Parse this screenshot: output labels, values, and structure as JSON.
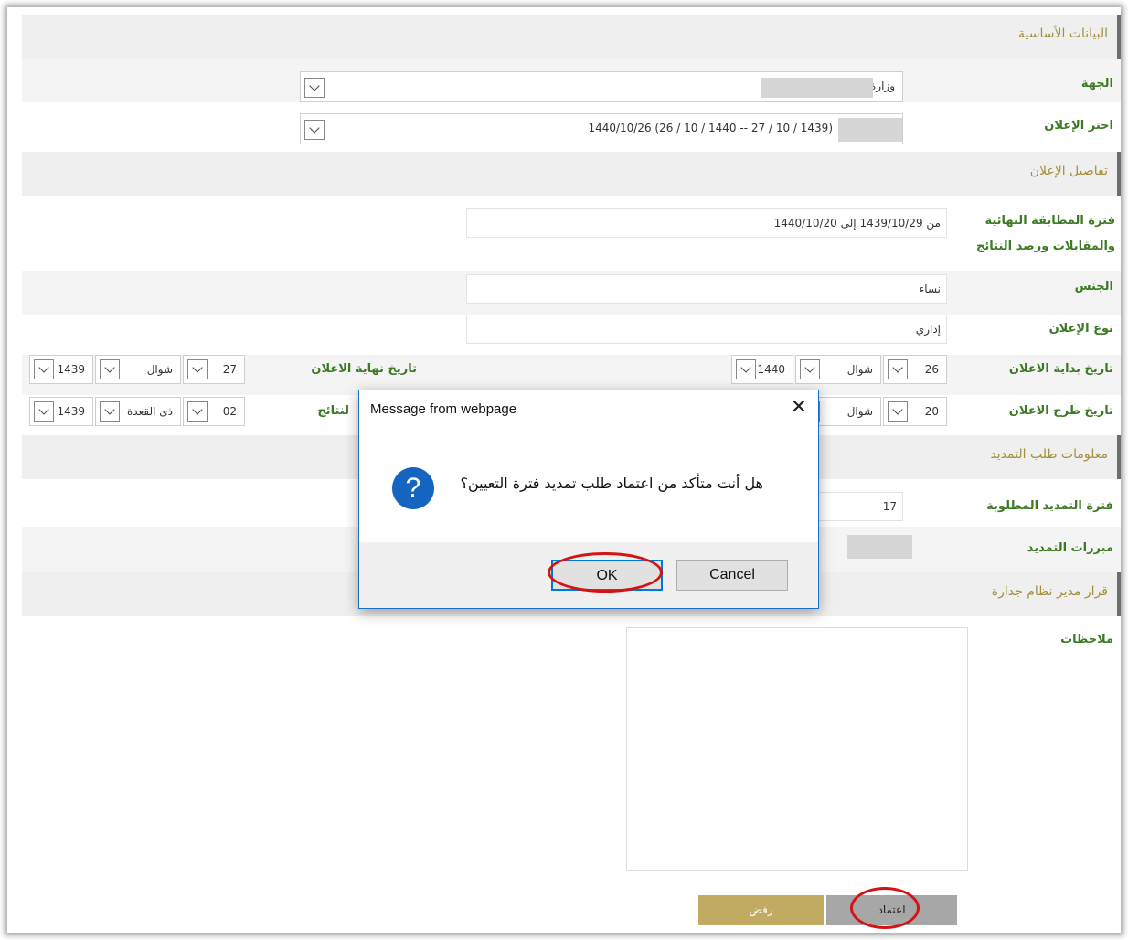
{
  "sections": {
    "basic": "البيانات الأساسية",
    "details": "تفاصيل الإعلان",
    "extension": "معلومات طلب التمديد",
    "decision": "قرار مدير نظام جدارة"
  },
  "basic": {
    "entity_label": "الجهة",
    "entity_value": "وزارة",
    "ad_label": "اختر الإعلان",
    "ad_value": "(1439 / 10 / 27 -- 1440 / 10 / 26) 1440/10/26"
  },
  "details": {
    "period_label": "فترة المطابقة النهائية والمقابلات ورصد النتائج",
    "period_value": "من 1439/10/29 إلى 1440/10/20",
    "gender_label": "الجنس",
    "gender_value": "نساء",
    "type_label": "نوع الإعلان",
    "type_value": "إداري",
    "start_label": "تاريخ بداية الاعلان",
    "start_day": "26",
    "start_month": "شوال",
    "start_year": "1440",
    "end_label": "تاريخ نهاية الاعلان",
    "end_day": "27",
    "end_month": "شوال",
    "end_year": "1439",
    "post_label": "تاريخ طرح الاعلان",
    "post_day": "20",
    "post_month": "شوال",
    "results_label_partial": "لنتائج",
    "results_day": "02",
    "results_month": "ذى القعدة",
    "results_year": "1439"
  },
  "extension": {
    "period_label": "فترة التمديد المطلوبة",
    "period_value": "17",
    "reasons_label": "مبررات التمديد"
  },
  "decision": {
    "notes_label": "ملاحظات",
    "approve": "اعتماد",
    "reject": "رفض"
  },
  "dialog": {
    "title": "Message from webpage",
    "message": "هل أنت متأكد من اعتماد طلب تمديد فترة التعيين؟",
    "icon": "?",
    "ok": "OK",
    "cancel": "Cancel",
    "close": "✕"
  },
  "colors": {
    "label_green": "#3d7a24",
    "section_gold": "#a38f3c",
    "approve_gray": "#a7a7a7",
    "reject_gold": "#c1ab63",
    "highlight_red": "#d31414",
    "dialog_accent": "#0078d7"
  }
}
